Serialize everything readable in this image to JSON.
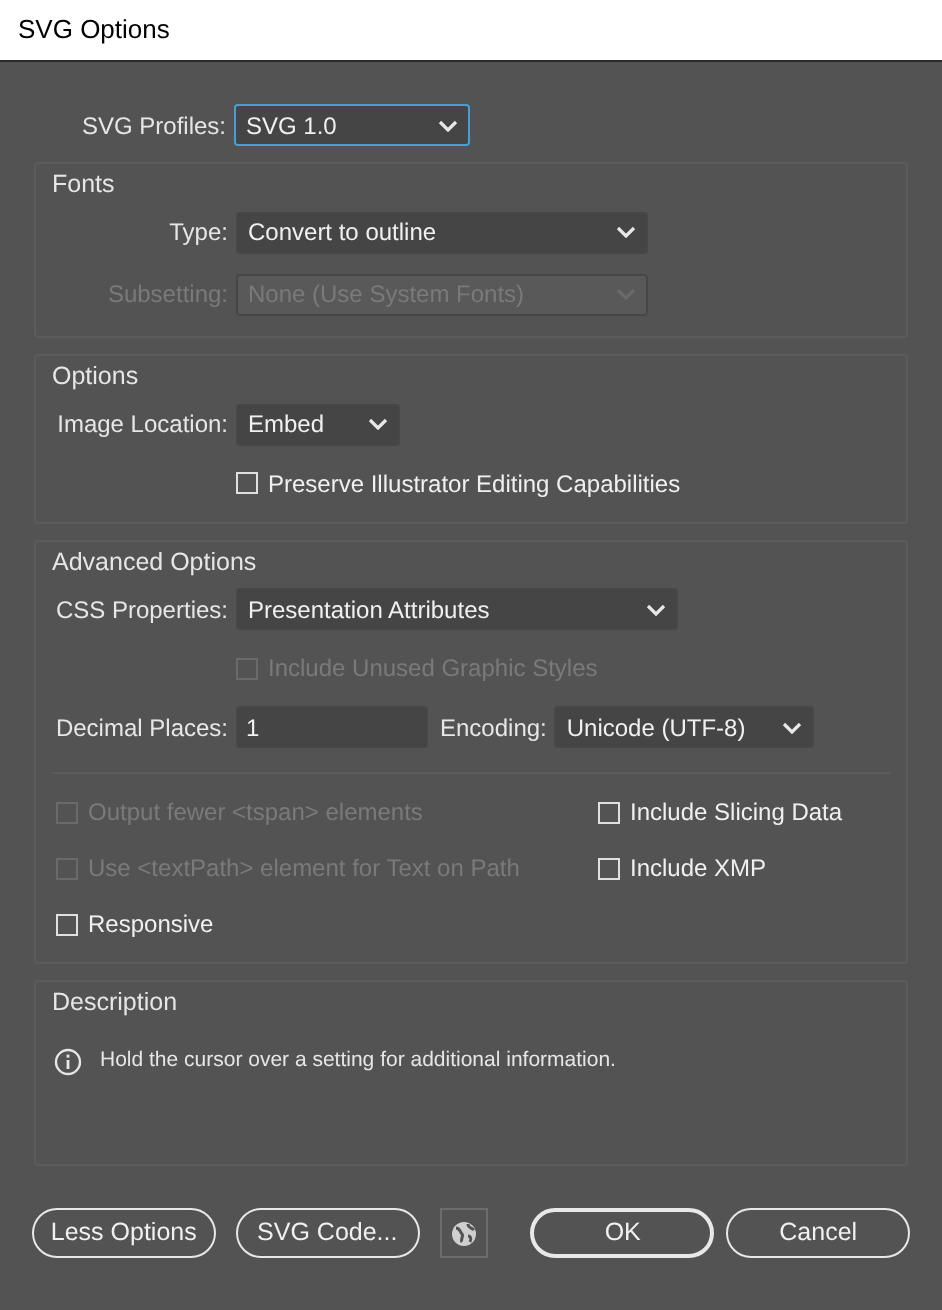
{
  "window": {
    "title": "SVG Options"
  },
  "profile": {
    "label": "SVG Profiles:",
    "value": "SVG 1.0",
    "focused": true
  },
  "sections": [
    {
      "title": "Fonts",
      "rows": [
        {
          "items": [
            {
              "kind": "select",
              "label": "Type:",
              "value": "Convert to outline",
              "disabled": false
            }
          ]
        },
        {
          "items": [
            {
              "kind": "select",
              "label": "Subsetting:",
              "value": "None (Use System Fonts)",
              "disabled": true
            }
          ]
        }
      ]
    },
    {
      "title": "Options",
      "rows": [
        {
          "items": [
            {
              "kind": "select",
              "label": "Image Location:",
              "value": "Embed",
              "disabled": false
            }
          ]
        },
        {
          "items": [
            {
              "kind": "checkbox",
              "label": "Preserve Illustrator Editing Capabilities",
              "checked": false,
              "disabled": false
            }
          ]
        }
      ]
    },
    {
      "title": "Advanced Options",
      "rows": [
        {
          "items": [
            {
              "kind": "select",
              "label": "CSS Properties:",
              "value": "Presentation Attributes",
              "disabled": false
            }
          ]
        },
        {
          "items": [
            {
              "kind": "checkbox",
              "label": "Include Unused Graphic Styles",
              "checked": false,
              "disabled": true
            }
          ]
        },
        {
          "items": [
            {
              "kind": "input",
              "label": "Decimal Places:",
              "value": "1"
            },
            {
              "kind": "select",
              "label": "Encoding:",
              "value": "Unicode (UTF-8)",
              "disabled": false
            }
          ]
        }
      ],
      "extras": [
        [
          {
            "label": "Output fewer <tspan> elements",
            "checked": false,
            "disabled": true
          },
          {
            "label": "Use <textPath> element for Text on Path",
            "checked": false,
            "disabled": true
          },
          {
            "label": "Responsive",
            "checked": false,
            "disabled": false
          }
        ],
        [
          {
            "label": "Include Slicing Data",
            "checked": false,
            "disabled": false
          },
          {
            "label": "Include XMP",
            "checked": false,
            "disabled": false
          }
        ]
      ]
    }
  ],
  "description": {
    "title": "Description",
    "text": "Hold the cursor over a setting for additional information."
  },
  "buttons": [
    {
      "kind": "text",
      "label": "Less Options"
    },
    {
      "kind": "text",
      "label": "SVG Code..."
    },
    {
      "kind": "globe"
    },
    {
      "kind": "text",
      "label": "OK",
      "default": true
    },
    {
      "kind": "text",
      "label": "Cancel",
      "default": false
    }
  ]
}
